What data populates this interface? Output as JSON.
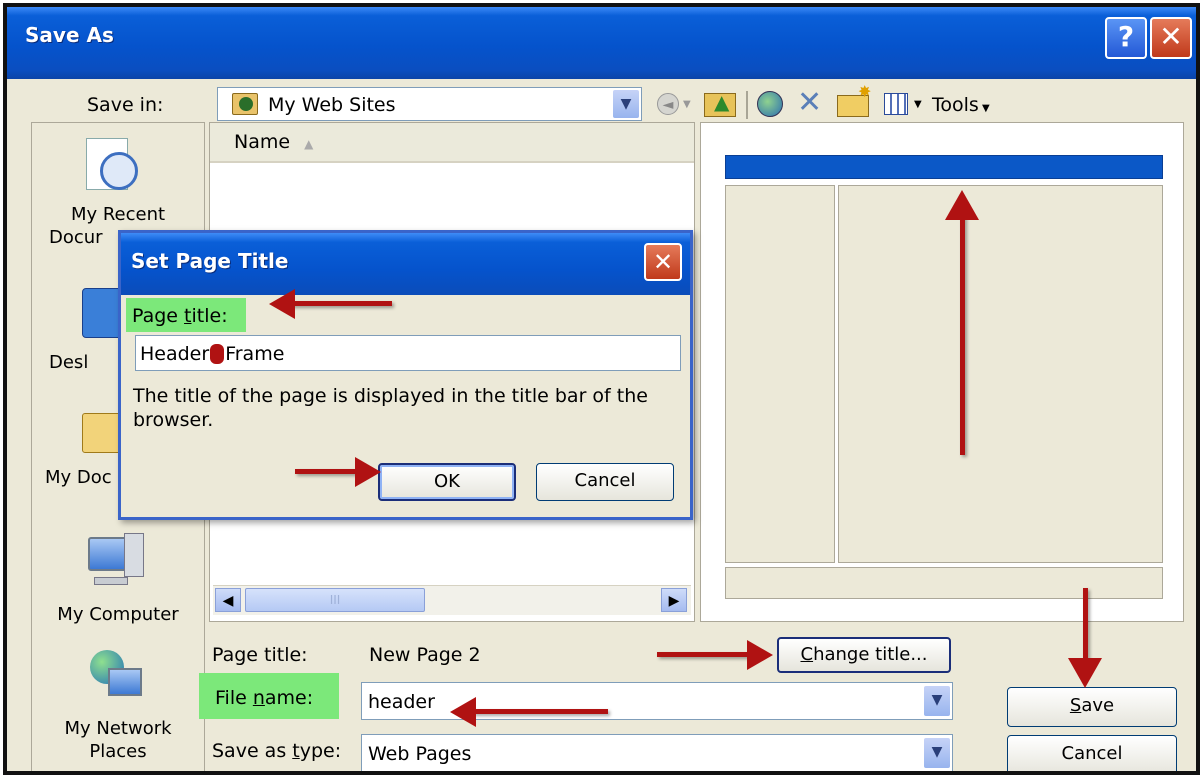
{
  "window": {
    "title": "Save As",
    "help_glyph": "?",
    "close_glyph": "✕"
  },
  "toolbar": {
    "save_in_label": "Save in:",
    "save_in_value": "My Web Sites",
    "tools_label": "Tools",
    "icons": [
      "folder-web-icon",
      "back-icon",
      "up-folder-icon",
      "search-web-icon",
      "delete-icon",
      "new-folder-icon",
      "views-icon"
    ]
  },
  "places": {
    "items": [
      {
        "label": "My Recent Documents",
        "line1": "My Recent",
        "line2": "Docur",
        "icon": "recent-documents-icon"
      },
      {
        "label": "Desktop",
        "line1": "Desl",
        "icon": "desktop-icon"
      },
      {
        "label": "My Documents",
        "line1": "My Doc",
        "icon": "my-documents-icon"
      },
      {
        "label": "My Computer",
        "line1": "My Computer",
        "icon": "computer-icon"
      },
      {
        "label": "My Network Places",
        "line1": "My Network",
        "line2": "Places",
        "icon": "network-places-icon"
      }
    ]
  },
  "filelist": {
    "column_name": "Name",
    "scroll_thumb": "III"
  },
  "form": {
    "page_title_label": "Page title:",
    "page_title_value": "New Page 2",
    "change_title_button": "Change title...",
    "file_name_label": "File name:",
    "file_name_value": "header",
    "save_type_label": "Save as type:",
    "save_type_value": "Web Pages",
    "save_button": "Save",
    "cancel_button": "Cancel"
  },
  "dialog": {
    "title": "Set Page Title",
    "close_glyph": "✕",
    "page_title_label": "Page title:",
    "input_value_part1": "Header",
    "input_value_part2": "Frame",
    "description_line1": "The title of the page is displayed in the title bar of the",
    "description_line2": "browser.",
    "ok_button": "OK",
    "cancel_button": "Cancel"
  },
  "colors": {
    "title_blue": "#0553cc",
    "annotation_red": "#b01212",
    "highlight_green": "#7ce87a",
    "dialog_face": "#ece9d8"
  }
}
